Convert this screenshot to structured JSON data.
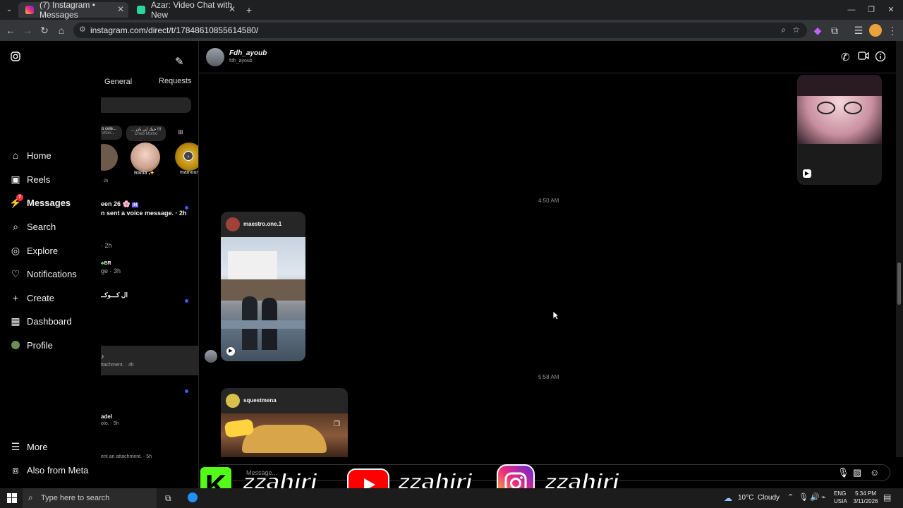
{
  "browser": {
    "tabs": [
      {
        "title": "(7) Instagram • Messages",
        "active": true
      },
      {
        "title": "Azar: Video Chat with New",
        "active": false
      }
    ],
    "url": "instagram.com/direct/t/17848610855614580/"
  },
  "leftnav": {
    "items": [
      {
        "label": "Home",
        "icon": "home-icon"
      },
      {
        "label": "Reels",
        "icon": "reels-icon"
      },
      {
        "label": "Messages",
        "icon": "messenger-icon",
        "badge": "7"
      },
      {
        "label": "Search",
        "icon": "search-icon"
      },
      {
        "label": "Explore",
        "icon": "compass-icon"
      },
      {
        "label": "Notifications",
        "icon": "heart-icon"
      },
      {
        "label": "Create",
        "icon": "plus-icon"
      },
      {
        "label": "Dashboard",
        "icon": "dashboard-icon"
      },
      {
        "label": "Profile",
        "icon": "avatar-icon"
      },
      {
        "label": "More",
        "icon": "menu-icon"
      },
      {
        "label": "Also from Meta",
        "icon": "meta-icon"
      }
    ]
  },
  "convlist": {
    "tabs": {
      "general": "General",
      "requests": "Requests"
    },
    "notes": [
      {
        "bubble": "o cele...",
        "sub": "Vitori...",
        "name": "",
        "time": "2h"
      },
      {
        "bubble": "... حبك لي بان !!!",
        "sub": "Cheb Momo",
        "name": "Rania ✨"
      },
      {
        "bubble": "",
        "sub": "",
        "name": "mamour"
      }
    ],
    "conversations": [
      {
        "name": "een 26",
        "meta": "n sent a voice message. · 2h",
        "unread": true
      },
      {
        "name": "",
        "meta": "· 2h",
        "unread": false
      },
      {
        "name": "BR",
        "meta": "ge · 3h",
        "unread": false
      },
      {
        "name": "ال كـــوكــ",
        "meta": "",
        "unread": true
      },
      {
        "name": "",
        "meta": "ttachment. · 4h",
        "unread": false,
        "selected": true
      },
      {
        "name": "",
        "meta": "",
        "unread": true
      },
      {
        "name": "adel",
        "meta": "oto. · 5h",
        "unread": false
      },
      {
        "name": "",
        "meta": "ent an attachment. · 5h",
        "unread": false
      }
    ]
  },
  "chat": {
    "header": {
      "name": "Fdh_ayoub",
      "username": "fdh_ayoub"
    },
    "timestamps": [
      "4:50 AM",
      "5:58 AM"
    ],
    "shared_posts": [
      {
        "account": "maestro.one.1"
      },
      {
        "account": "squestmena"
      }
    ],
    "composer_placeholder": "Message..."
  },
  "taskbar": {
    "search_placeholder": "Type here to search",
    "weather": "10°C  Cloudy",
    "lang": "ENG",
    "region": "USIA",
    "time": "5:34 PM",
    "date": "3/11/2026"
  },
  "watermark": {
    "texts": [
      "zzahiri",
      "zzahiri",
      "zzahiri_"
    ],
    "letter": "K"
  },
  "colors": {
    "unread": "#3b5bff",
    "badge": "#ff3040",
    "youtube": "#ff0000",
    "kick": "#53fc18"
  }
}
